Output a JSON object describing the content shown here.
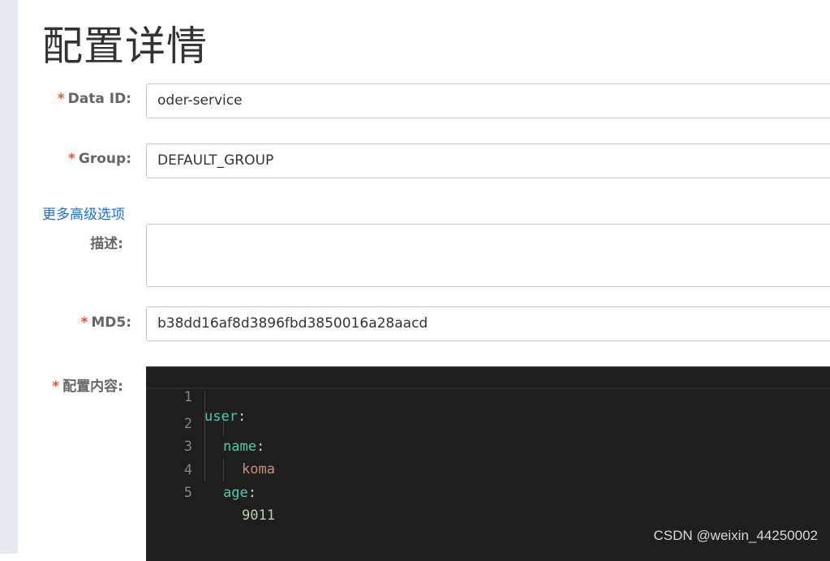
{
  "page": {
    "title": "配置详情"
  },
  "form": {
    "data_id": {
      "label": "Data ID:",
      "required": "*",
      "value": "oder-service"
    },
    "group": {
      "label": "Group:",
      "required": "*",
      "value": "DEFAULT_GROUP"
    },
    "advanced_link": "更多高级选项",
    "description": {
      "label": "描述:",
      "value": ""
    },
    "md5": {
      "label": "MD5:",
      "required": "*",
      "value": "b38dd16af8d3896fbd3850016a28aacd"
    },
    "content": {
      "label": "配置内容:",
      "required": "*"
    }
  },
  "editor": {
    "lines": [
      {
        "num": "1",
        "key": "user",
        "punc": ":"
      },
      {
        "num": "2",
        "key": "name",
        "punc": ":"
      },
      {
        "num": "3",
        "value": "koma"
      },
      {
        "num": "4",
        "key": "age",
        "punc": ":"
      },
      {
        "num": "5",
        "value": "9011"
      }
    ],
    "colors": {
      "background": "#1e1e1e",
      "key": "#4ec9b0",
      "string": "#ce9178",
      "number": "#b5cea8",
      "line_number": "#858585"
    }
  },
  "watermark": "CSDN @weixin_44250002"
}
